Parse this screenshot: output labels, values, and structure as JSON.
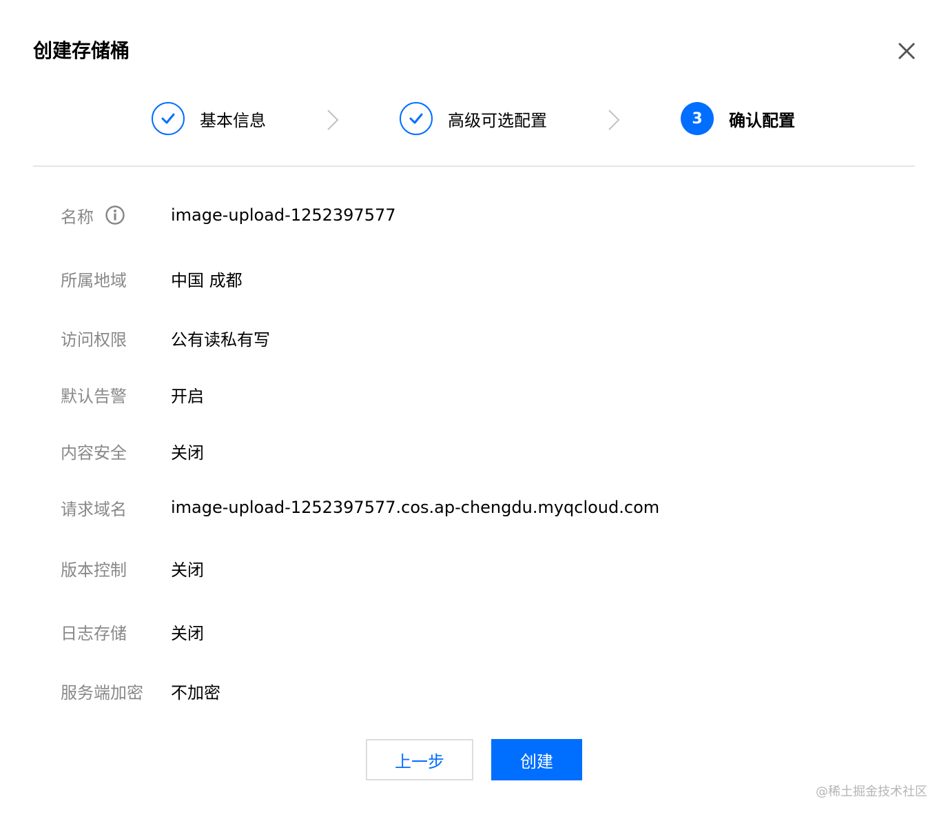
{
  "dialog": {
    "title": "创建存储桶",
    "close_icon": "close-icon"
  },
  "steps": [
    {
      "label": "基本信息",
      "status": "done",
      "icon": "check-icon"
    },
    {
      "label": "高级可选配置",
      "status": "done",
      "icon": "check-icon"
    },
    {
      "label": "确认配置",
      "status": "active",
      "number": "3"
    }
  ],
  "step_separator_icon": "chevron-right-icon",
  "fields": [
    {
      "label": "名称",
      "value": "image-upload-1252397577",
      "icon": "info-icon"
    },
    {
      "label": "所属地域",
      "value": "中国 成都"
    },
    {
      "label": "访问权限",
      "value": "公有读私有写"
    },
    {
      "label": "默认告警",
      "value": "开启"
    },
    {
      "label": "内容安全",
      "value": "关闭"
    },
    {
      "label": "请求域名",
      "value": "image-upload-1252397577.cos.ap-chengdu.myqcloud.com"
    },
    {
      "label": "版本控制",
      "value": "关闭"
    },
    {
      "label": "日志存储",
      "value": "关闭"
    },
    {
      "label": "服务端加密",
      "value": "不加密"
    }
  ],
  "buttons": {
    "prev_label": "上一步",
    "create_label": "创建"
  },
  "watermark": "@稀土掘金技术社区",
  "colors": {
    "primary": "#006eff",
    "label_gray": "#888888",
    "divider": "#e5e5e5",
    "text": "#000000"
  }
}
